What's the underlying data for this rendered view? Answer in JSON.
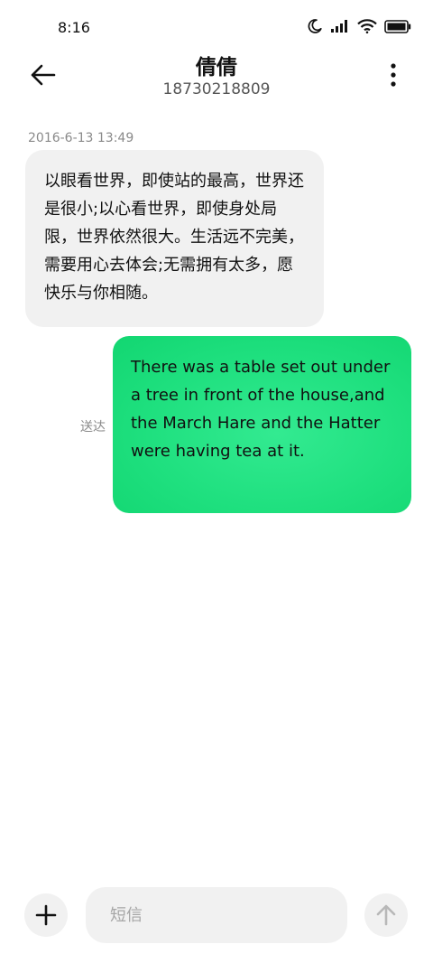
{
  "status_bar": {
    "time": "8:16",
    "icons": [
      "moon-icon",
      "signal-icon",
      "wifi-icon",
      "battery-icon"
    ]
  },
  "header": {
    "title": "倩倩",
    "subtitle": "18730218809",
    "back_icon": "arrow-left-icon",
    "more_icon": "more-vertical-icon"
  },
  "conversation": {
    "timestamp": "2016-6-13 13:49",
    "incoming_message": "以眼看世界，即使站的最高，世界还是很小;以心看世界，即使身处局限，世界依然很大。生活远不完美，需要用心去体会;无需拥有太多，愿快乐与你相随。",
    "outgoing_message": "There was a table set out under a tree in front of the house,and the March Hare and the Hatter were having tea at it.",
    "outgoing_status": "送达"
  },
  "composer": {
    "placeholder": "短信",
    "value": "",
    "add_icon": "plus-icon",
    "send_icon": "arrow-up-icon"
  },
  "colors": {
    "incoming_bubble": "#f1f1f1",
    "outgoing_bubble": "#1fe07f",
    "secondary_text": "#8a8a8a"
  }
}
